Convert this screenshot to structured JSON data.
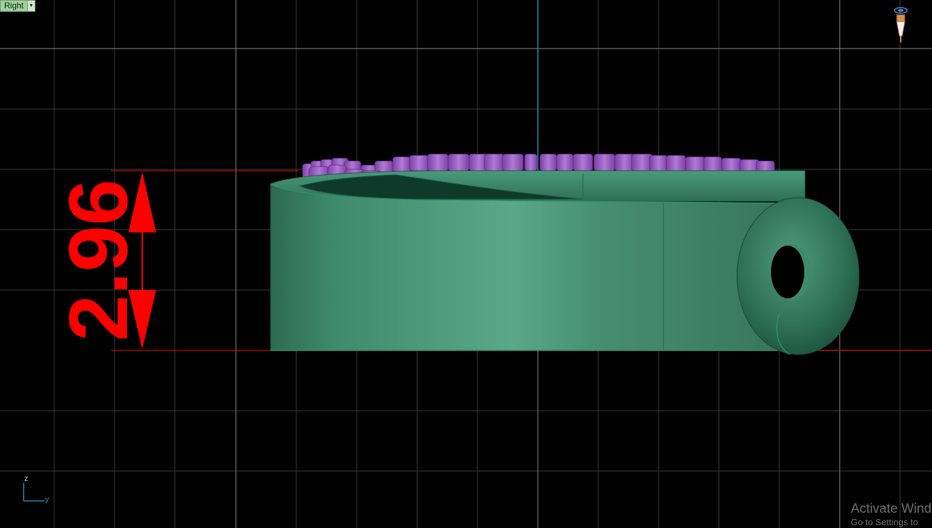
{
  "viewport": {
    "name": "Right",
    "menu_icon": "dropdown-arrow-icon",
    "background": "#000000"
  },
  "dimension": {
    "value": "2.96",
    "color": "#ff0000"
  },
  "axis_indicator": {
    "vertical": "z",
    "horizontal": "y"
  },
  "gumball_icon": "pin-gizmo-icon",
  "watermark": {
    "title": "Activate Wind",
    "subtitle": "Go to Settings to"
  },
  "colors": {
    "grid": "#3a3a3a",
    "grid_major": "#8a8a8a",
    "z_axis": "#2a8aa8",
    "y_axis": "#c01010",
    "body_green": "#3d8a6e",
    "gem_purple": "#9a5cc0"
  }
}
